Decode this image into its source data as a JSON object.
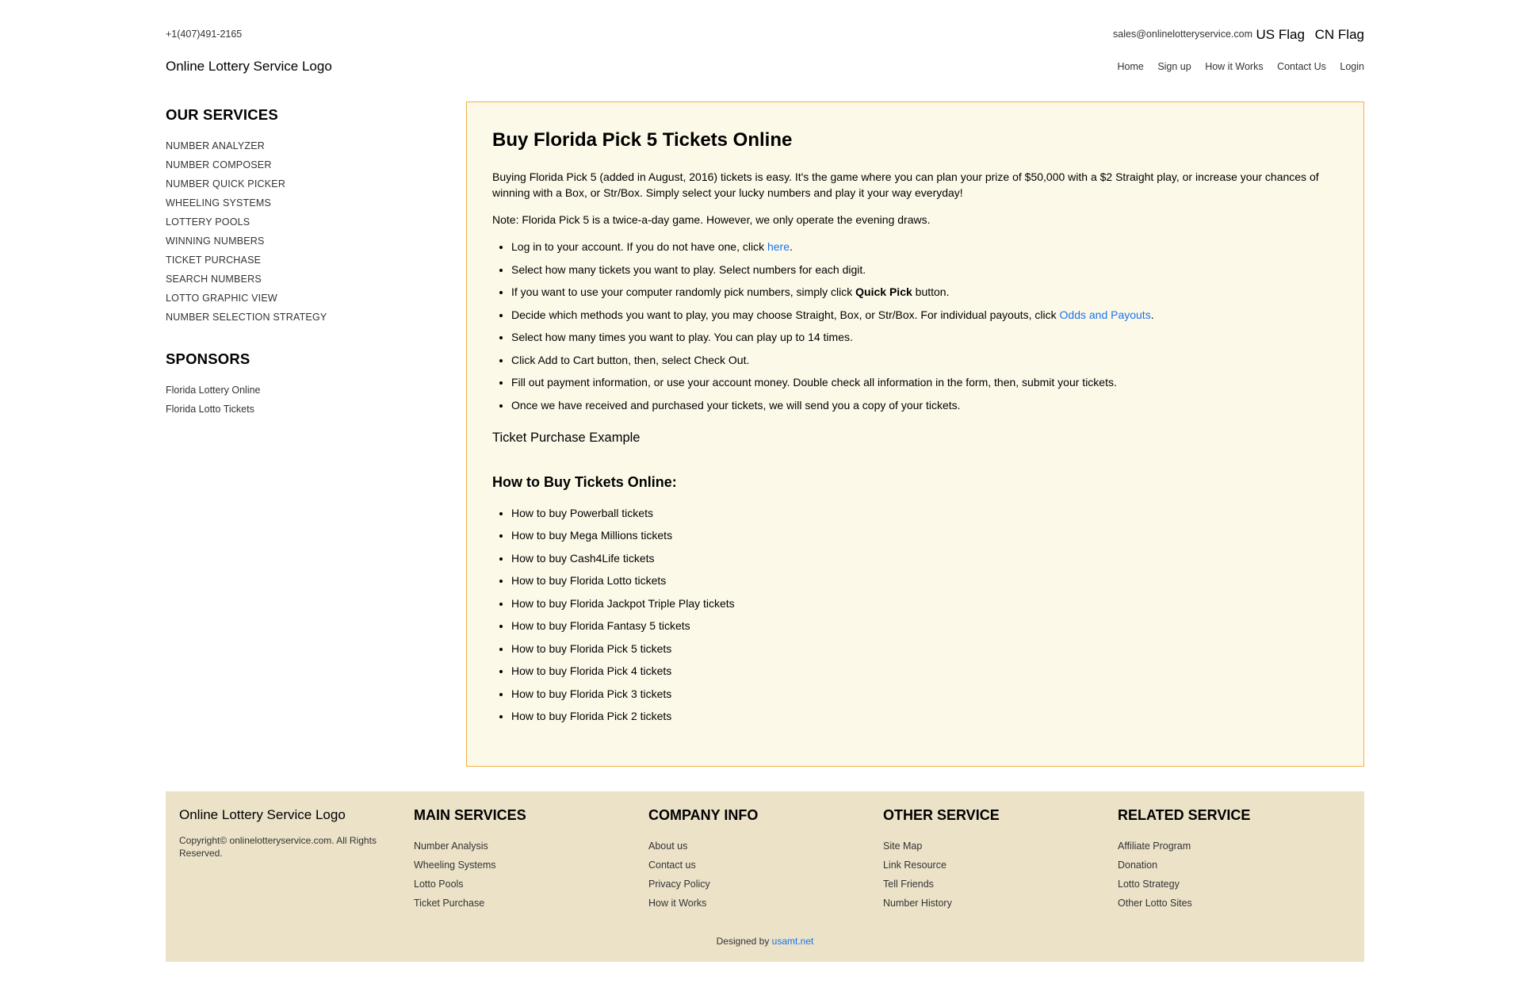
{
  "header": {
    "phone": "+1(407)491-2165",
    "email": "sales@onlinelotteryservice.com",
    "flags": [
      "US Flag",
      "CN Flag"
    ],
    "logo": "Online Lottery Service Logo",
    "nav": [
      "Home",
      "Sign up",
      "How it Works",
      "Contact Us",
      "Login"
    ]
  },
  "sidebar": {
    "services_title": "OUR SERVICES",
    "services": [
      "NUMBER ANALYZER",
      "NUMBER COMPOSER",
      "NUMBER QUICK PICKER",
      "WHEELING SYSTEMS",
      "LOTTERY POOLS",
      "WINNING NUMBERS",
      "TICKET PURCHASE",
      "SEARCH NUMBERS",
      "LOTTO GRAPHIC VIEW",
      "NUMBER SELECTION STRATEGY"
    ],
    "sponsors_title": "SPONSORS",
    "sponsors": [
      "Florida Lottery Online",
      "Florida Lotto Tickets"
    ]
  },
  "main": {
    "title": "Buy Florida Pick 5 Tickets Online",
    "intro": "Buying Florida Pick 5 (added in August, 2016) tickets is easy. It's the game where you can plan your prize of $50,000 with a $2 Straight play, or increase your chances of winning with a Box, or Str/Box. Simply select your lucky numbers and play it your way everyday!",
    "note": "Note: Florida Pick 5 is a twice-a-day game. However, we only operate the evening draws.",
    "steps": {
      "s1_text": "Log in to your account. If you do not have one, click ",
      "s1_link": "here",
      "s1_end": ".",
      "s2": "Select how many tickets you want to play. Select numbers for each digit.",
      "s3_text": "If you want to use your computer randomly pick numbers, simply click ",
      "s3_bold": "Quick Pick",
      "s3_end": " button.",
      "s4_text": "Decide which methods you want to play, you may choose Straight, Box, or Str/Box. For individual payouts, click ",
      "s4_link": "Odds and Payouts",
      "s4_end": ".",
      "s5": "Select how many times you want to play. You can play up to 14 times.",
      "s6": "Click Add to Cart button, then, select Check Out.",
      "s7": "Fill out payment information, or use your account money. Double check all information in the form, then, submit your tickets.",
      "s8": "Once we have received and purchased your tickets, we will send you a copy of your tickets."
    },
    "example": "Ticket Purchase Example",
    "howto_title": "How to Buy Tickets Online:",
    "howto": [
      "How to buy Powerball tickets",
      "How to buy Mega Millions tickets",
      "How to buy Cash4Life tickets",
      "How to buy Florida Lotto tickets",
      "How to buy Florida Jackpot Triple Play tickets",
      "How to buy Florida Fantasy 5 tickets",
      "How to buy Florida Pick 5 tickets",
      "How to buy Florida Pick 4 tickets",
      "How to buy Florida Pick 3 tickets",
      "How to buy Florida Pick 2 tickets"
    ]
  },
  "footer": {
    "logo": "Online Lottery Service Logo",
    "copyright": "Copyright© onlinelotteryservice.com. All Rights Reserved.",
    "columns": [
      {
        "title": "MAIN SERVICES",
        "items": [
          "Number Analysis",
          "Wheeling Systems",
          "Lotto Pools",
          "Ticket Purchase"
        ]
      },
      {
        "title": "COMPANY INFO",
        "items": [
          "About us",
          "Contact us",
          "Privacy Policy",
          "How it Works"
        ]
      },
      {
        "title": "OTHER SERVICE",
        "items": [
          "Site Map",
          "Link Resource",
          "Tell Friends",
          "Number History"
        ]
      },
      {
        "title": "RELATED SERVICE",
        "items": [
          "Affiliate Program",
          "Donation",
          "Lotto Strategy",
          "Other Lotto Sites"
        ]
      }
    ],
    "designed_by": "Designed by ",
    "designer": "usamt.net"
  },
  "colors": {
    "main_bg": "#fdf9e9",
    "main_border": "#f0b04a",
    "footer_bg": "#ebe2c8",
    "link": "#1a73e8"
  }
}
